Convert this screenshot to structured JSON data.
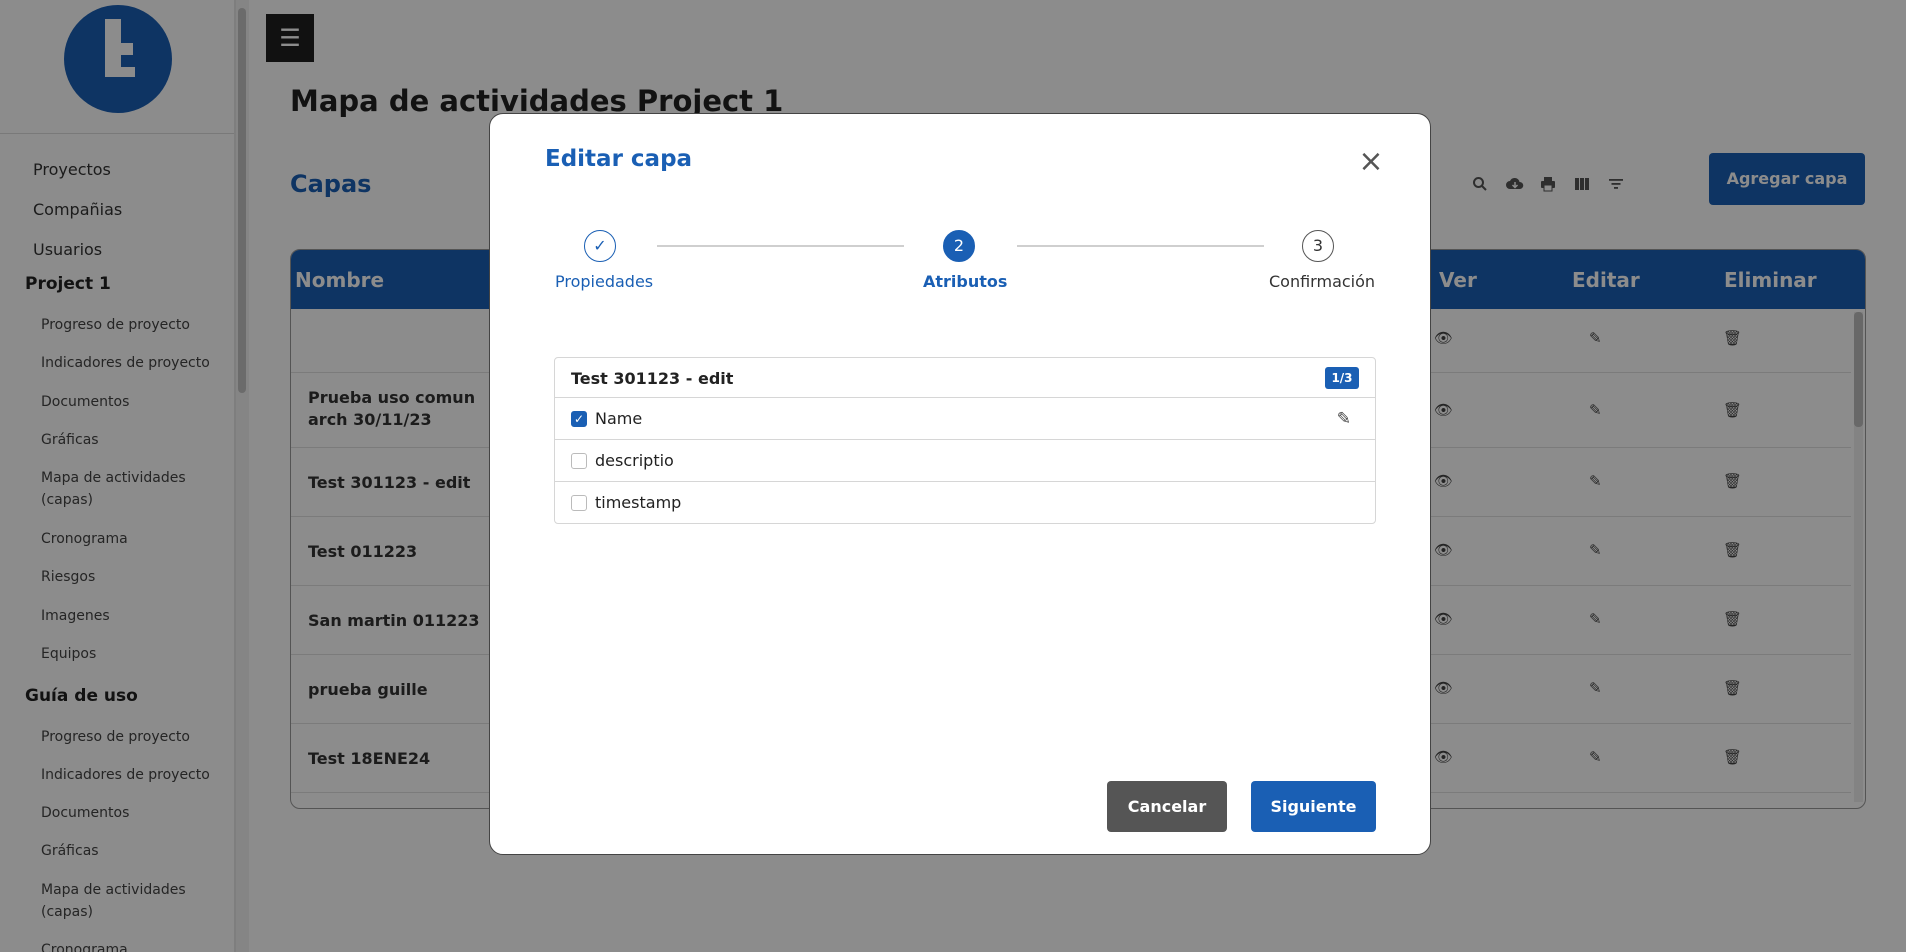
{
  "sidebar": {
    "top_items": [
      {
        "label": "Proyectos"
      },
      {
        "label": "Compañias"
      },
      {
        "label": "Usuarios"
      }
    ],
    "section1": {
      "title": "Project 1",
      "items": [
        {
          "label": "Progreso de proyecto"
        },
        {
          "label": "Indicadores de proyecto"
        },
        {
          "label": "Documentos"
        },
        {
          "label": "Gráficas"
        },
        {
          "label": "Mapa de actividades (capas)"
        },
        {
          "label": "Cronograma"
        },
        {
          "label": "Riesgos"
        },
        {
          "label": "Imagenes"
        },
        {
          "label": "Equipos"
        }
      ]
    },
    "section2": {
      "title": "Guía de uso",
      "items": [
        {
          "label": "Progreso de proyecto"
        },
        {
          "label": "Indicadores de proyecto"
        },
        {
          "label": "Documentos"
        },
        {
          "label": "Gráficas"
        },
        {
          "label": "Mapa de actividades (capas)"
        },
        {
          "label": "Cronograma"
        }
      ]
    }
  },
  "header": {
    "menu_icon": "☰",
    "title": "Mapa de actividades Project 1"
  },
  "layers": {
    "title": "Capas",
    "add_button": "Agregar capa",
    "toolbar_icons": [
      "search-icon",
      "cloud-download-icon",
      "print-icon",
      "columns-icon",
      "filter-icon"
    ],
    "columns": {
      "name": "Nombre",
      "view": "Ver",
      "edit": "Editar",
      "delete": "Eliminar"
    },
    "rows": [
      {
        "name": ""
      },
      {
        "name": "Prueba uso comun arch 30/11/23"
      },
      {
        "name": "Test 301123 - edit"
      },
      {
        "name": "Test 011223"
      },
      {
        "name": "San martin 011223"
      },
      {
        "name": "prueba guille"
      },
      {
        "name": "Test 18ENE24"
      }
    ]
  },
  "modal": {
    "title": "Editar capa",
    "close_symbol": "×",
    "steps": [
      {
        "number": "✓",
        "label": "Propiedades",
        "state": "completed"
      },
      {
        "number": "2",
        "label": "Atributos",
        "state": "active"
      },
      {
        "number": "3",
        "label": "Confirmación",
        "state": "pending"
      }
    ],
    "attributes": {
      "layer_name": "Test 301123 - edit",
      "badge": "1/3",
      "items": [
        {
          "label": "Name",
          "checked": true
        },
        {
          "label": "descriptio",
          "checked": false
        },
        {
          "label": "timestamp",
          "checked": false
        }
      ]
    },
    "cancel_button": "Cancelar",
    "next_button": "Siguiente"
  },
  "colors": {
    "primary": "#1a5fb4",
    "cancel": "#555555"
  }
}
